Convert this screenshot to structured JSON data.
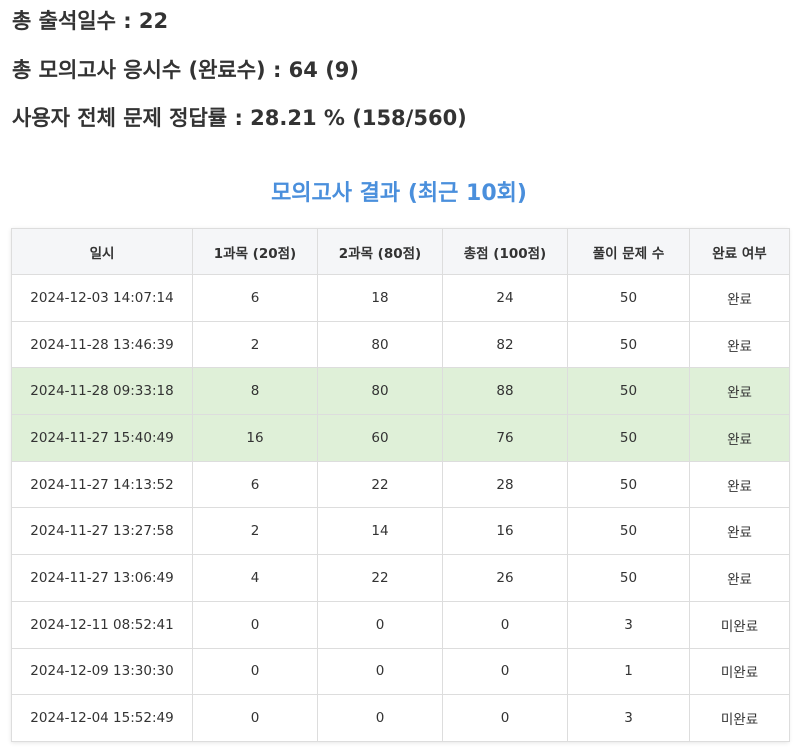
{
  "stats": {
    "attendance": "총 출석일수 : 22",
    "mock_exams": "총 모의고사 응시수 (완료수) : 64 (9)",
    "accuracy": "사용자 전체 문제 정답률 : 28.21 % (158/560)"
  },
  "results": {
    "title": "모의고사 결과 (최근 10회)",
    "headers": [
      "일시",
      "1과목 (20점)",
      "2과목 (80점)",
      "총점 (100점)",
      "풀이 문제 수",
      "완료 여부"
    ],
    "rows": [
      {
        "datetime": "2024-12-03 14:07:14",
        "subject1": "6",
        "subject2": "18",
        "total": "24",
        "solved": "50",
        "status": "완료",
        "highlight": false
      },
      {
        "datetime": "2024-11-28 13:46:39",
        "subject1": "2",
        "subject2": "80",
        "total": "82",
        "solved": "50",
        "status": "완료",
        "highlight": false
      },
      {
        "datetime": "2024-11-28 09:33:18",
        "subject1": "8",
        "subject2": "80",
        "total": "88",
        "solved": "50",
        "status": "완료",
        "highlight": true
      },
      {
        "datetime": "2024-11-27 15:40:49",
        "subject1": "16",
        "subject2": "60",
        "total": "76",
        "solved": "50",
        "status": "완료",
        "highlight": true
      },
      {
        "datetime": "2024-11-27 14:13:52",
        "subject1": "6",
        "subject2": "22",
        "total": "28",
        "solved": "50",
        "status": "완료",
        "highlight": false
      },
      {
        "datetime": "2024-11-27 13:27:58",
        "subject1": "2",
        "subject2": "14",
        "total": "16",
        "solved": "50",
        "status": "완료",
        "highlight": false
      },
      {
        "datetime": "2024-11-27 13:06:49",
        "subject1": "4",
        "subject2": "22",
        "total": "26",
        "solved": "50",
        "status": "완료",
        "highlight": false
      },
      {
        "datetime": "2024-12-11 08:52:41",
        "subject1": "0",
        "subject2": "0",
        "total": "0",
        "solved": "3",
        "status": "미완료",
        "highlight": false
      },
      {
        "datetime": "2024-12-09 13:30:30",
        "subject1": "0",
        "subject2": "0",
        "total": "0",
        "solved": "1",
        "status": "미완료",
        "highlight": false
      },
      {
        "datetime": "2024-12-04 15:52:49",
        "subject1": "0",
        "subject2": "0",
        "total": "0",
        "solved": "3",
        "status": "미완료",
        "highlight": false
      }
    ]
  },
  "colors": {
    "title_accent": "#4a8fdc",
    "highlight_row": "#dff0d8",
    "header_bg": "#f5f6f8"
  }
}
